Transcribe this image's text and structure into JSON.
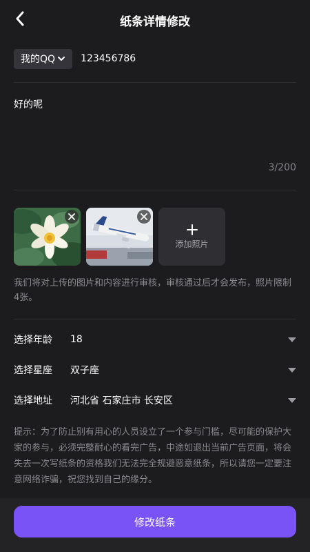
{
  "header": {
    "title": "纸条详情修改",
    "back_icon": "chevron-left-icon"
  },
  "contact": {
    "type_label": "我的QQ",
    "value": "123456786"
  },
  "message": {
    "text": "好的呢",
    "count": "3/200"
  },
  "photos": {
    "items": [
      {
        "subject": "lotus-flower"
      },
      {
        "subject": "airplane-takeoff"
      }
    ],
    "add_label": "添加照片",
    "add_icon": "plus-icon",
    "remove_icon": "close-icon"
  },
  "notice": "我们将对上传的图片和内容进行审核，审核通过后才会发布，照片限制4张。",
  "fields": [
    {
      "label": "选择年龄",
      "value": "18"
    },
    {
      "label": "选择星座",
      "value": "双子座"
    },
    {
      "label": "选择地址",
      "value": "河北省 石家庄市 长安区"
    }
  ],
  "tip": "提示：为了防止别有用心的人员设立了一个参与门槛，尽可能的保护大家的参与，必须完整耐心的看完广告，中途如退出当前广告页面，将会失去一次写纸条的资格我们无法完全规避恶意纸条，所以请您一定要注意网络诈骗，祝您找到自己的缘分。",
  "submit_label": "修改纸条",
  "colors": {
    "accent": "#7a53f7",
    "background": "#1c1c1e",
    "muted_text": "#8a8a90"
  }
}
